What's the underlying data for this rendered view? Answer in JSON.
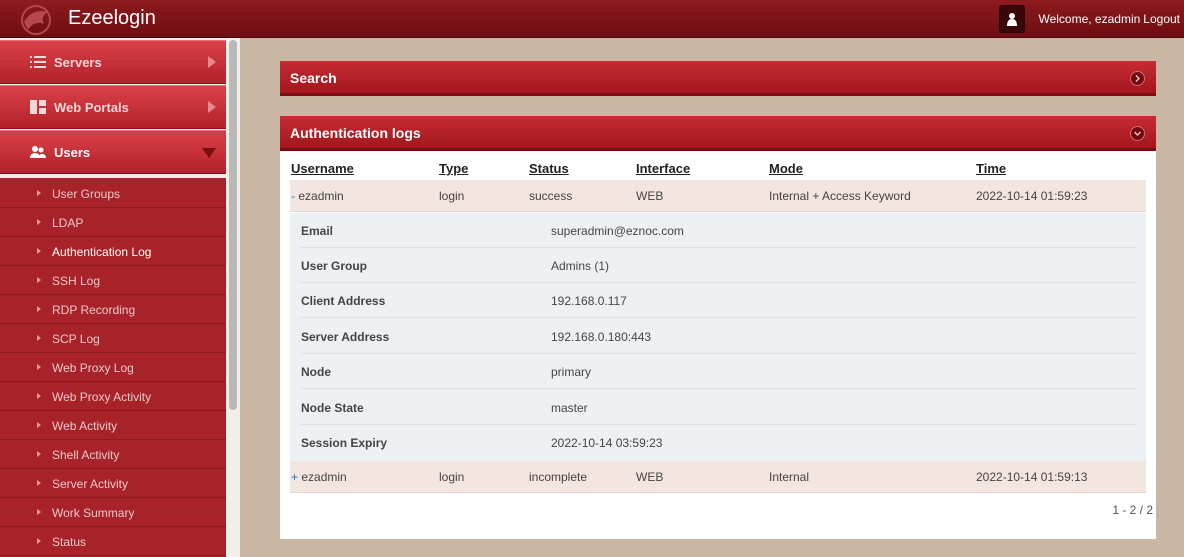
{
  "app": {
    "title": "Ezeelogin"
  },
  "user_area": {
    "welcome": "Welcome, ezadmin",
    "logout": "Logout"
  },
  "sidebar": {
    "top_items": [
      {
        "label": "Servers",
        "icon": "list-icon"
      },
      {
        "label": "Web Portals",
        "icon": "dashboard-icon"
      },
      {
        "label": "Users",
        "icon": "users-icon"
      }
    ],
    "sub_items": [
      "User Groups",
      "LDAP",
      "Authentication Log",
      "SSH Log",
      "RDP Recording",
      "SCP Log",
      "Web Proxy Log",
      "Web Proxy Activity",
      "Web Activity",
      "Shell Activity",
      "Server Activity",
      "Work Summary",
      "Status"
    ]
  },
  "search_panel": {
    "title": "Search"
  },
  "auth_panel": {
    "title": "Authentication logs",
    "columns": [
      "Username",
      "Type",
      "Status",
      "Interface",
      "Mode",
      "Time"
    ],
    "rows": [
      {
        "toggle": "-",
        "username": "ezadmin",
        "type": "login",
        "status": "success",
        "interface": "WEB",
        "mode": "Internal + Access Keyword",
        "time": "2022-10-14 01:59:23"
      },
      {
        "toggle": "+",
        "username": "ezadmin",
        "type": "login",
        "status": "incomplete",
        "interface": "WEB",
        "mode": "Internal",
        "time": "2022-10-14 01:59:13"
      }
    ],
    "details": [
      {
        "key": "Email",
        "value": "superadmin@eznoc.com"
      },
      {
        "key": "User Group",
        "value": "Admins (1)"
      },
      {
        "key": "Client Address",
        "value": "192.168.0.117"
      },
      {
        "key": "Server Address",
        "value": "192.168.0.180:443"
      },
      {
        "key": "Node",
        "value": "primary"
      },
      {
        "key": "Node State",
        "value": "master"
      },
      {
        "key": "Session Expiry",
        "value": "2022-10-14 03:59:23"
      }
    ],
    "pagination": "1 - 2 / 2"
  }
}
